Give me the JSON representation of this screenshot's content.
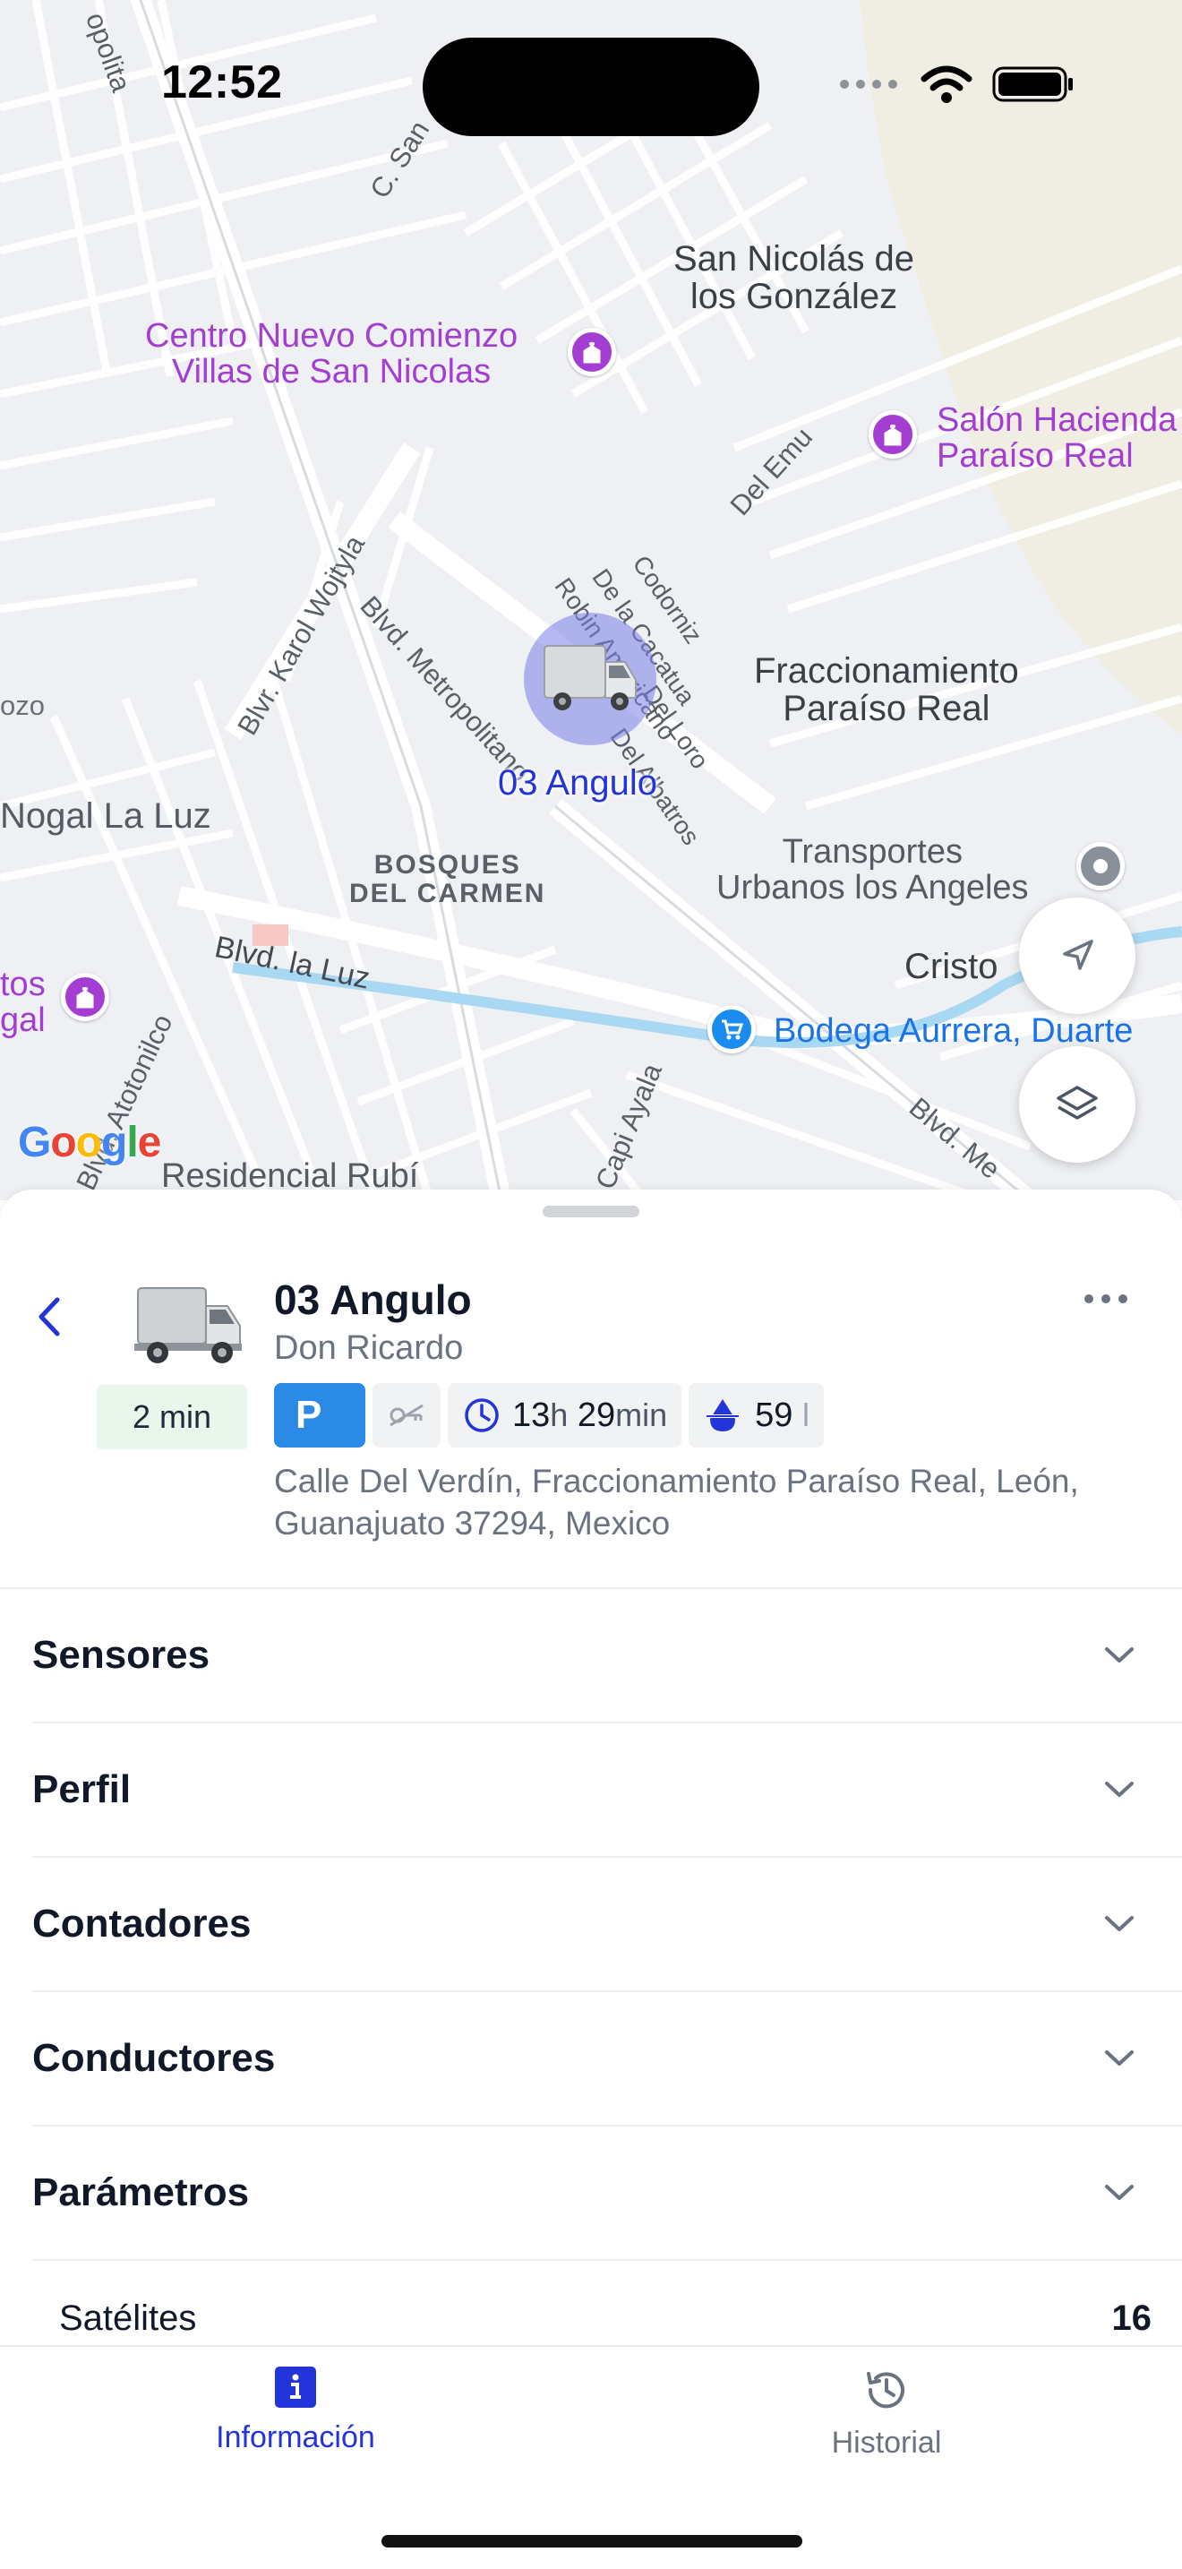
{
  "status_bar": {
    "time": "12:52"
  },
  "map": {
    "labels": {
      "san_nicolas": "San Nicolás de\nlos González",
      "centro_nuevo": "Centro Nuevo Comienzo\nVillas de San Nicolas",
      "salon_hacienda": "Salón Hacienda\nParaíso Real",
      "fraccionamiento": "Fraccionamiento\nParaíso Real",
      "bosques": "BOSQUES\nDEL CARMEN",
      "transportes": "Transportes\nUrbanos los Angeles",
      "cristo": "Cristo",
      "bodega": "Bodega Aurrera, Duarte",
      "nogal": "Nogal La Luz",
      "residencial": "Residencial Rubí",
      "tos_gal": "tos\ngal",
      "ozo": "ozo",
      "road_karol": "Blvr. Karol Wojtyla",
      "road_metropolitano": "Blvd. Metropolitano",
      "road_la_luz": "Blvd. la Luz",
      "road_atotonilco": "Blvd. Atotonilco",
      "road_capi": "Capi Ayala",
      "road_del_emu": "Del Emu",
      "road_codorniz": "Codorniz",
      "road_cacatua": "De la Cacatua",
      "road_robin": "Robin Americano",
      "road_loro": "Del Loro",
      "road_albatros": "Del Albatros",
      "road_c_san": "C. San",
      "road_blvd_me": "Blvd. Me",
      "road_top": "opolita"
    },
    "vehicle_marker_label": "03 Angulo",
    "google_logo": "Google"
  },
  "vehicle": {
    "name": "03 Angulo",
    "driver": "Don Ricardo",
    "last_update": "2 min",
    "parking_label": "P",
    "duration_hours": "13",
    "duration_hours_unit": "h",
    "duration_minutes": "29",
    "duration_minutes_unit": "min",
    "fuel_value": "59",
    "fuel_unit": "l",
    "address": "Calle Del Verdín, Fraccionamiento Paraíso Real, León, Guanajuato 37294, Mexico"
  },
  "sections": [
    {
      "title": "Sensores"
    },
    {
      "title": "Perfil"
    },
    {
      "title": "Contadores"
    },
    {
      "title": "Conductores"
    },
    {
      "title": "Parámetros"
    }
  ],
  "parameters": {
    "satellites_label": "Satélites",
    "satellites_value": "16"
  },
  "tabs": {
    "info": "Información",
    "history": "Historial"
  },
  "colors": {
    "accent": "#2334d8",
    "parking_chip": "#2b8ae6",
    "time_badge_bg": "#e8f6ec",
    "poi": "#a43ed2",
    "marker_halo": "#787ee6"
  },
  "icons": {
    "back": "chevron-left-icon",
    "more": "ellipsis-icon",
    "navigate": "navigation-arrow-icon",
    "layers": "layers-icon",
    "ignition_off": "ignition-off-icon",
    "clock": "clock-icon",
    "fuel": "fuel-icon",
    "info_tab": "info-icon",
    "history_tab": "history-icon"
  }
}
